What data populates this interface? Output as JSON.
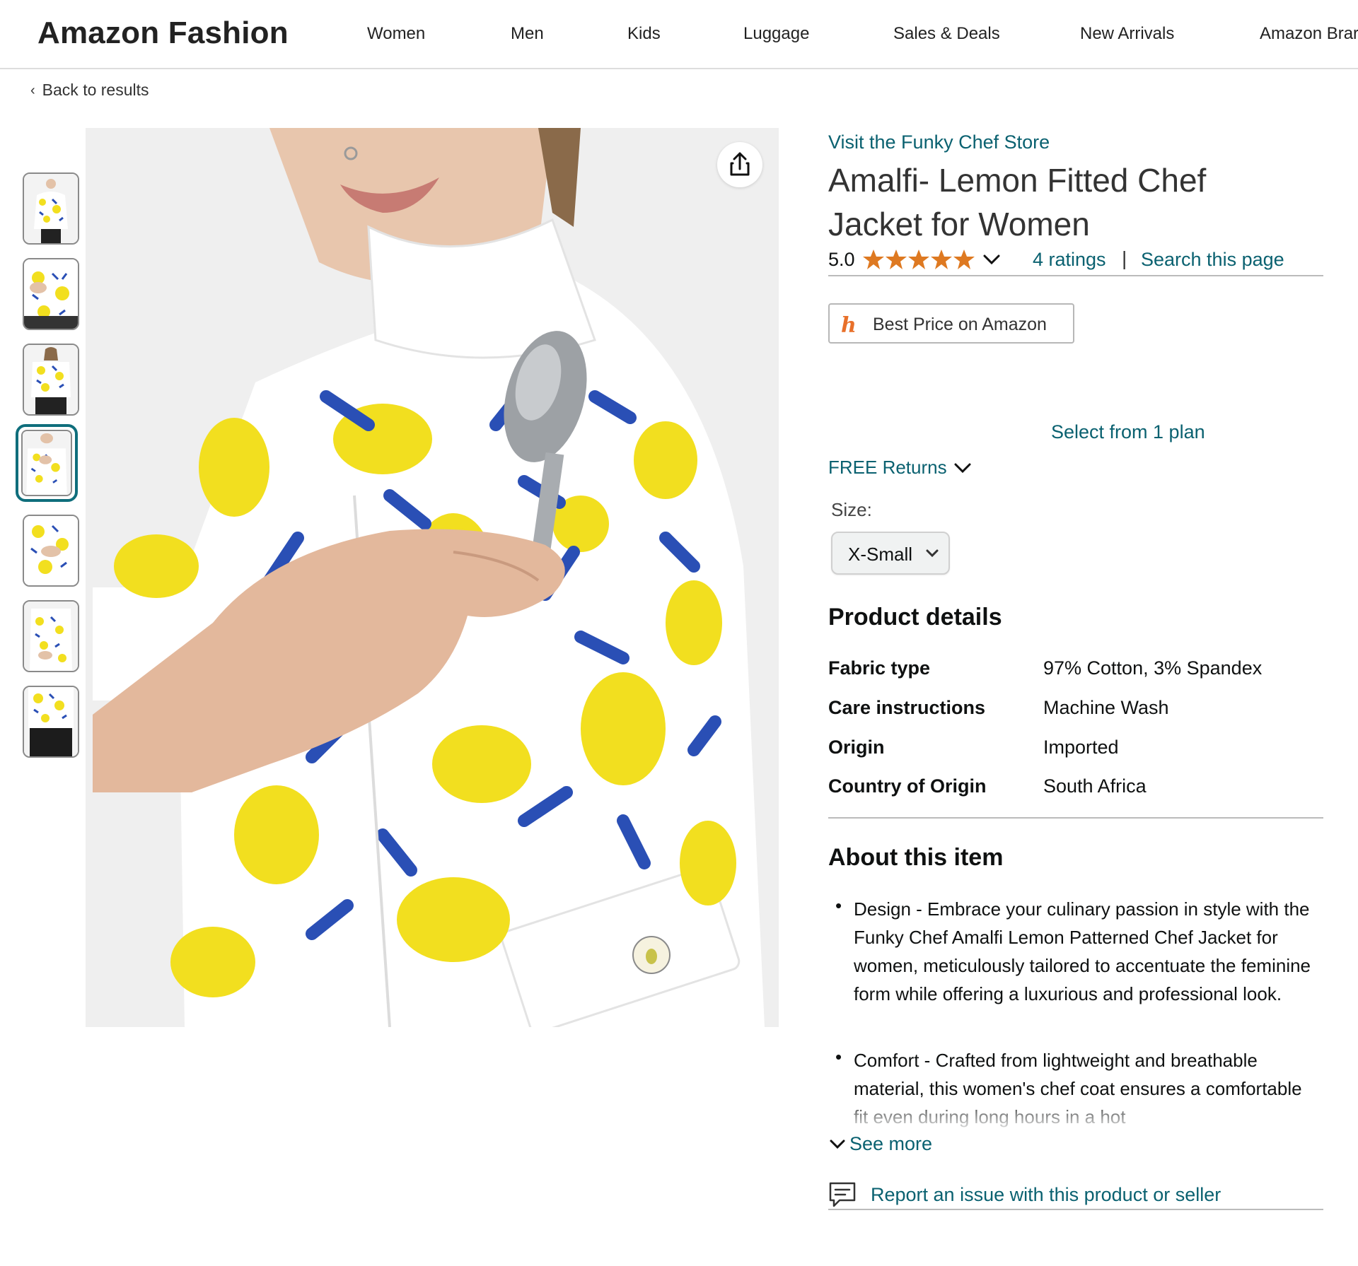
{
  "header": {
    "brand": "Amazon Fashion",
    "nav": [
      "Women",
      "Men",
      "Kids",
      "Luggage",
      "Sales & Deals",
      "New Arrivals",
      "Amazon Brar"
    ]
  },
  "breadcrumb": {
    "back_label": "Back to results"
  },
  "gallery": {
    "thumbnail_count": 7,
    "selected_index": 3
  },
  "product": {
    "store_link": "Visit the Funky Chef Store",
    "title": "Amalfi- Lemon Fitted Chef Jacket for Women",
    "rating_value": "5.0",
    "rating_stars": 5,
    "ratings_link": "4 ratings",
    "separator": "|",
    "search_link": "Search this page",
    "best_price_label": "Best Price on Amazon",
    "plan_link": "Select from 1 plan",
    "returns_label": "FREE Returns",
    "size_label": "Size:",
    "size_value": "X-Small"
  },
  "details": {
    "title": "Product details",
    "rows": [
      {
        "key": "Fabric type",
        "value": "97% Cotton, 3% Spandex"
      },
      {
        "key": "Care instructions",
        "value": "Machine Wash"
      },
      {
        "key": "Origin",
        "value": "Imported"
      },
      {
        "key": "Country of Origin",
        "value": "South Africa"
      }
    ]
  },
  "about": {
    "title": "About this item",
    "bullets": [
      "Design - Embrace your culinary passion in style with the Funky Chef Amalfi Lemon Patterned Chef Jacket for women, meticulously tailored to accentuate the feminine form while offering a luxurious and professional look.",
      "Comfort - Crafted from lightweight and breathable material, this women's chef coat ensures a comfortable fit even during long hours in a hot"
    ],
    "see_more": "See more"
  },
  "footer": {
    "report_label": "Report an issue with this product or seller"
  },
  "colors": {
    "link": "#0a6170",
    "star": "#de7921",
    "selected_thumb_border": "#0f6e7c",
    "lemon": "#f2df1f",
    "leaf": "#2a4fb5"
  },
  "icons": [
    "chevron-left-icon",
    "share-icon",
    "star-icon",
    "chevron-down-icon",
    "honey-h-icon",
    "report-chat-icon"
  ]
}
